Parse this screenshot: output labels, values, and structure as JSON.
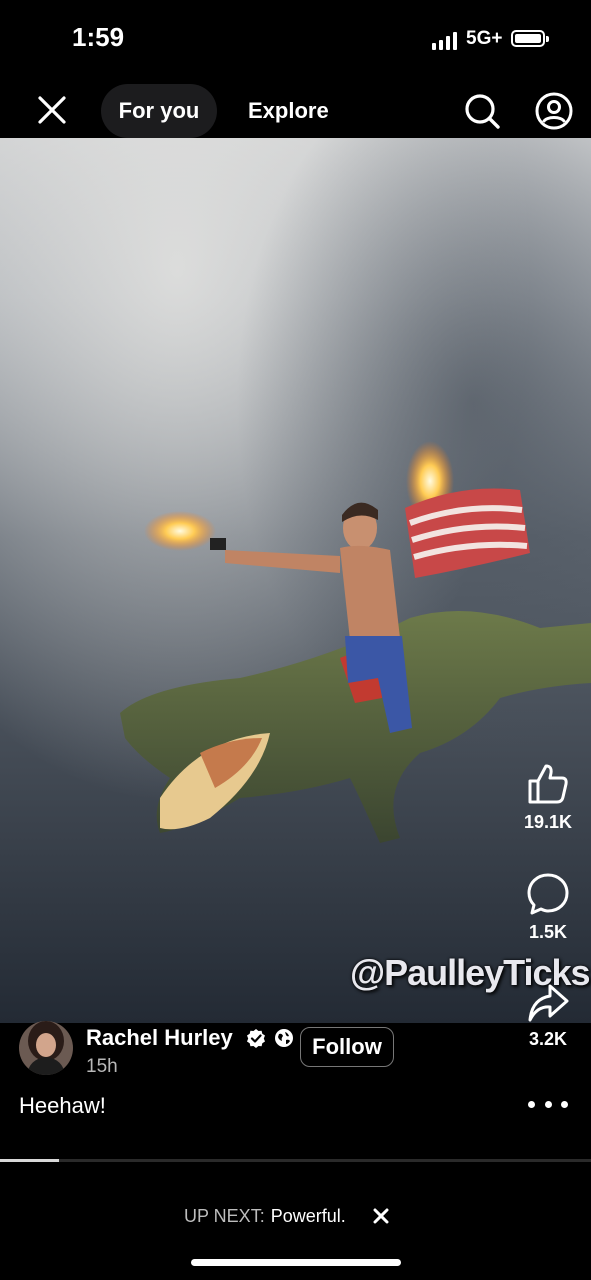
{
  "status": {
    "time": "1:59",
    "network": "5G+"
  },
  "nav": {
    "tabs": [
      {
        "label": "For you",
        "active": true
      },
      {
        "label": "Explore",
        "active": false
      }
    ],
    "icons": [
      "close-icon",
      "search-icon",
      "profile-icon"
    ]
  },
  "video": {
    "watermark": "@PaulleyTicks"
  },
  "actions": {
    "like_count": "19.1K",
    "comment_count": "1.5K",
    "share_count": "3.2K"
  },
  "post": {
    "author": "Rachel Hurley",
    "time_ago": "15h",
    "follow_label": "Follow",
    "caption": "Heehaw!",
    "badges": [
      "verified-icon",
      "globe-icon"
    ]
  },
  "playback": {
    "progress_fraction": 0.1
  },
  "up_next": {
    "label": "UP NEXT:",
    "title": "Powerful."
  },
  "colors": {
    "background": "#000000",
    "tab_active_bg": "#1c1c1e",
    "secondary_text": "#b8b8b8"
  }
}
